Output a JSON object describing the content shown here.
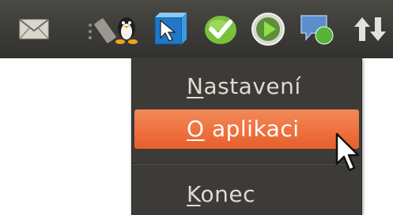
{
  "panel": {
    "icons": [
      {
        "name": "mail-icon"
      },
      {
        "name": "penguin-icon"
      },
      {
        "name": "cursor-app-icon"
      },
      {
        "name": "check-icon"
      },
      {
        "name": "play-icon"
      },
      {
        "name": "chat-icon"
      },
      {
        "name": "network-arrows-icon"
      }
    ]
  },
  "menu": {
    "items": [
      {
        "mnemonic": "N",
        "rest": "astavení"
      },
      {
        "mnemonic": "O",
        "rest": " aplikaci"
      },
      {
        "mnemonic": "K",
        "rest": "onec"
      }
    ],
    "active_index": 1
  },
  "colors": {
    "panel": "#3c3b37",
    "menu_bg": "#3c3b37",
    "highlight": "#ee6f3c",
    "menu_text": "#dfdbd2"
  }
}
